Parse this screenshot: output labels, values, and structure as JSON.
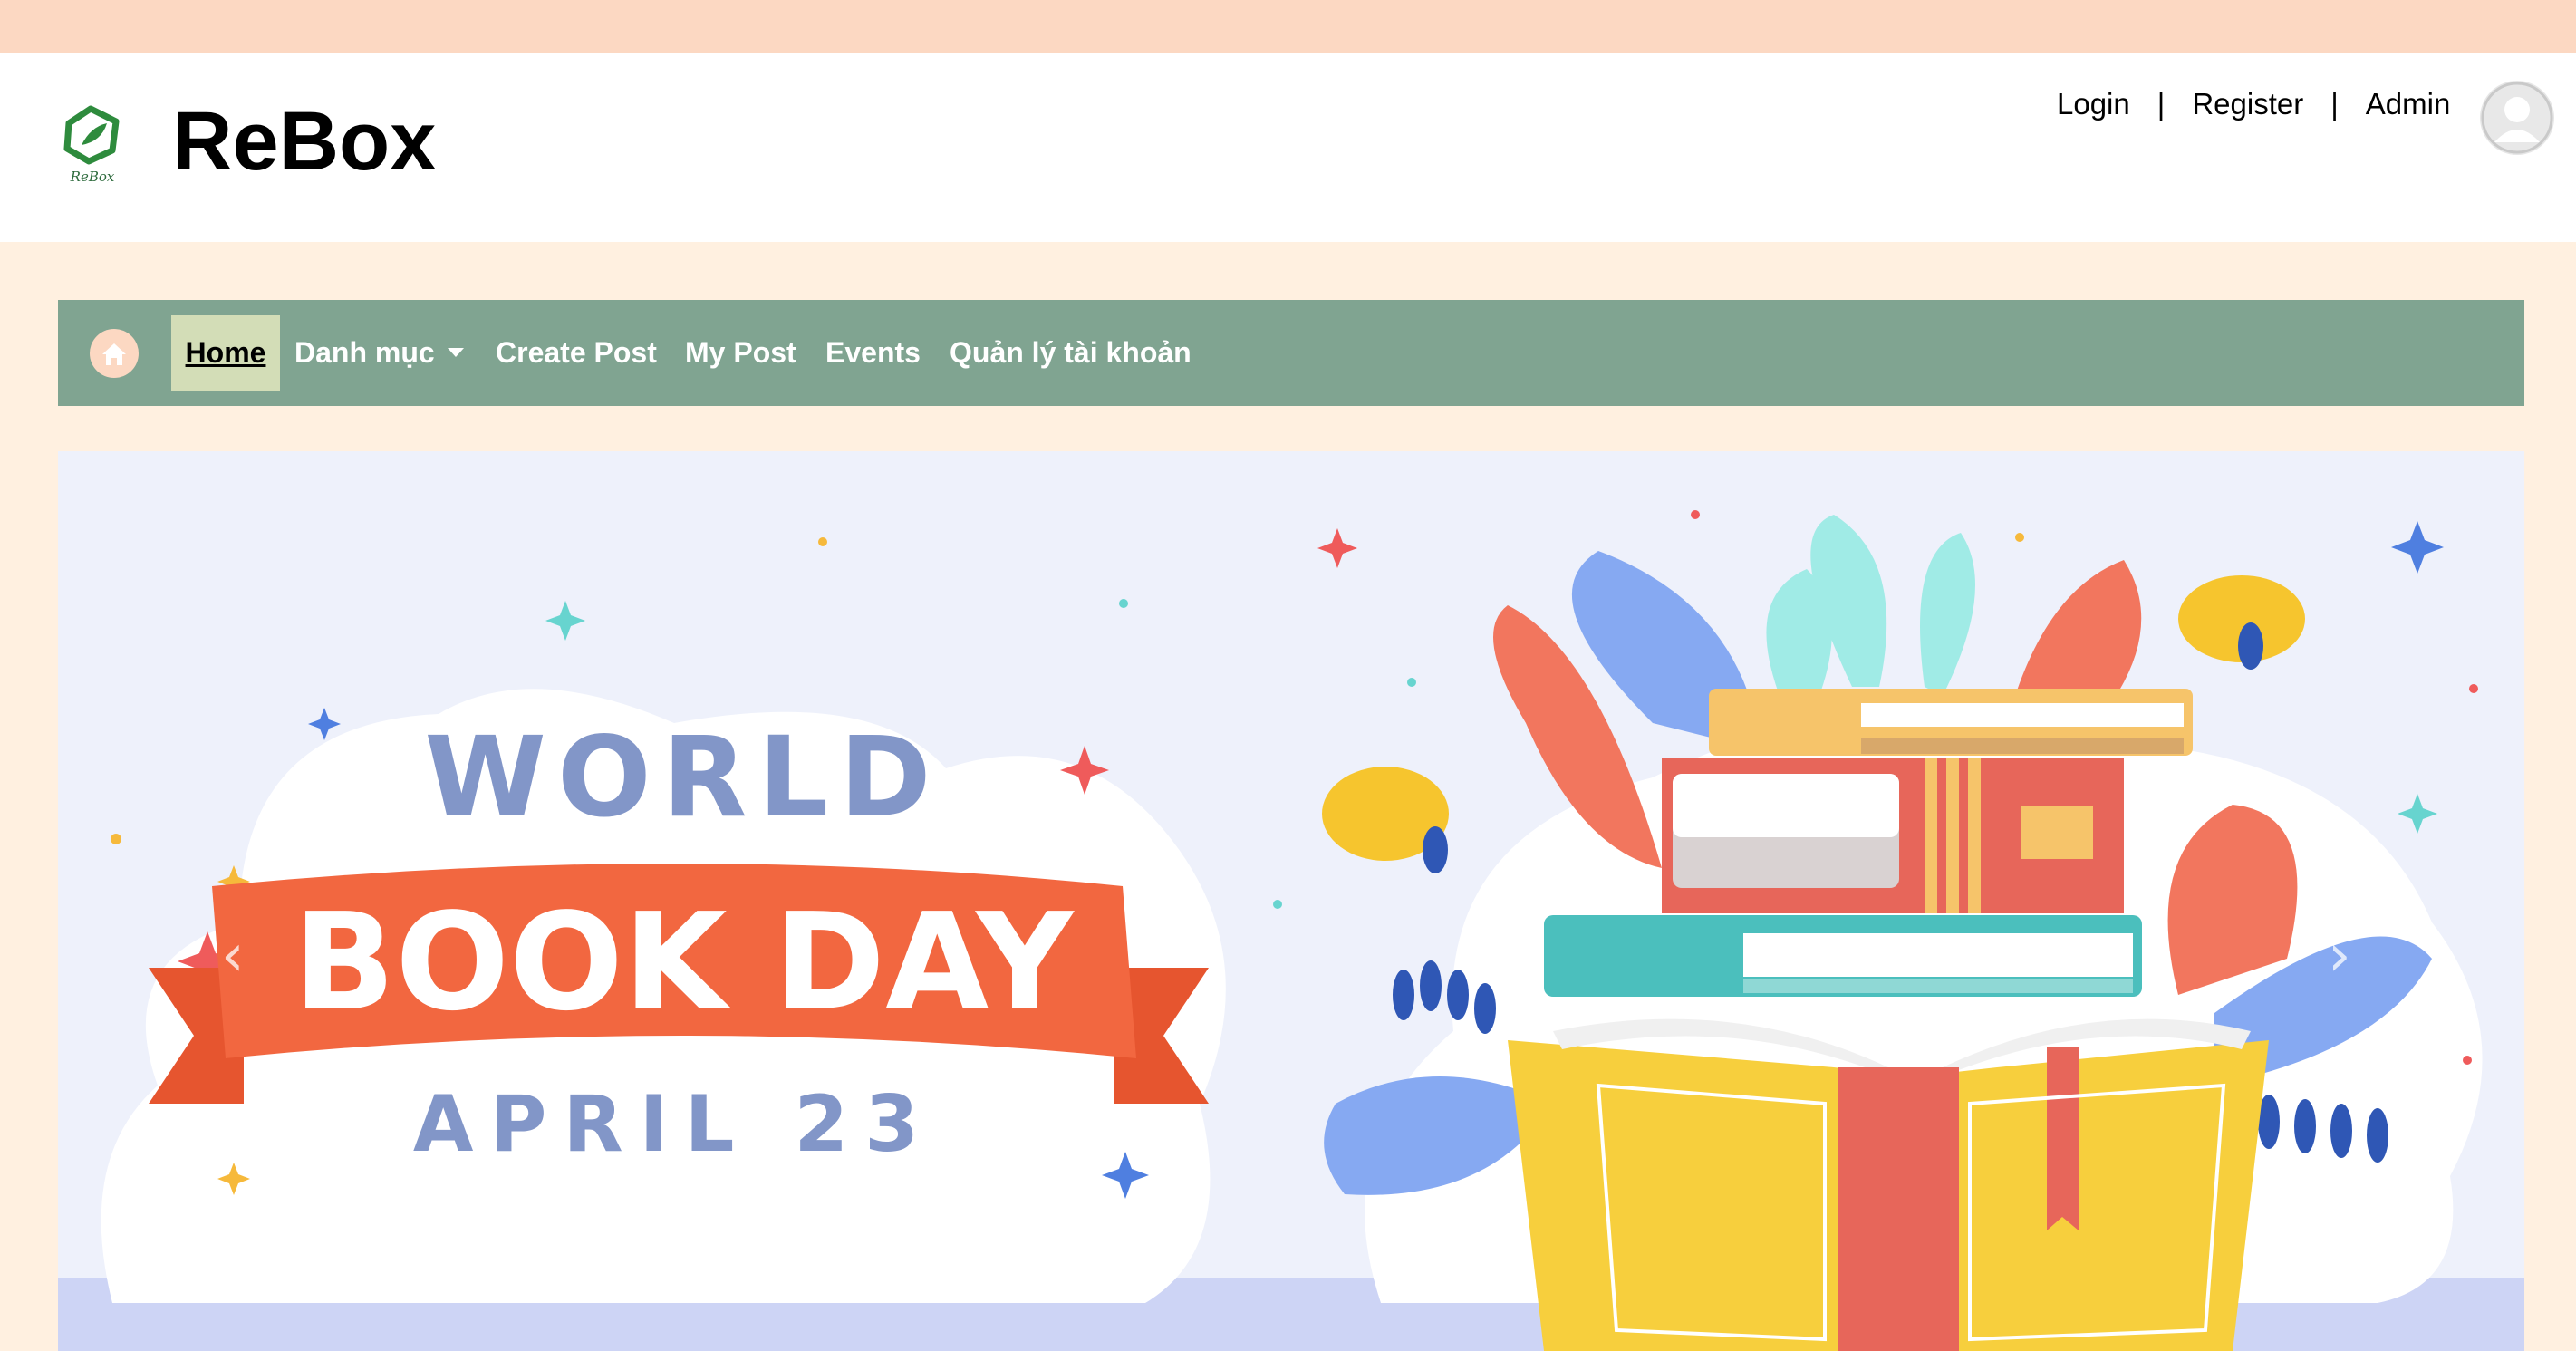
{
  "brand": {
    "name": "ReBox",
    "logo_caption": "ReBox"
  },
  "auth": {
    "login": "Login",
    "register": "Register",
    "admin": "Admin",
    "separator": "|"
  },
  "nav": {
    "home": "Home",
    "categories": "Danh mục",
    "create_post": "Create Post",
    "my_post": "My Post",
    "events": "Events",
    "account": "Quản lý tài khoản"
  },
  "banner": {
    "line1": "WORLD",
    "line2": "BOOK DAY",
    "line3": "APRIL 23",
    "prev_icon": "‹",
    "next_icon": "›"
  },
  "colors": {
    "topbar": "#fcd8c2",
    "page_bg": "#fff0e0",
    "nav_bg": "#80a491",
    "nav_active_bg": "#d3ddb7",
    "ribbon": "#f26740",
    "title_blue": "#8296c8"
  },
  "icons": {
    "home": "home-icon",
    "avatar": "user-avatar-icon",
    "caret": "chevron-down-icon"
  }
}
